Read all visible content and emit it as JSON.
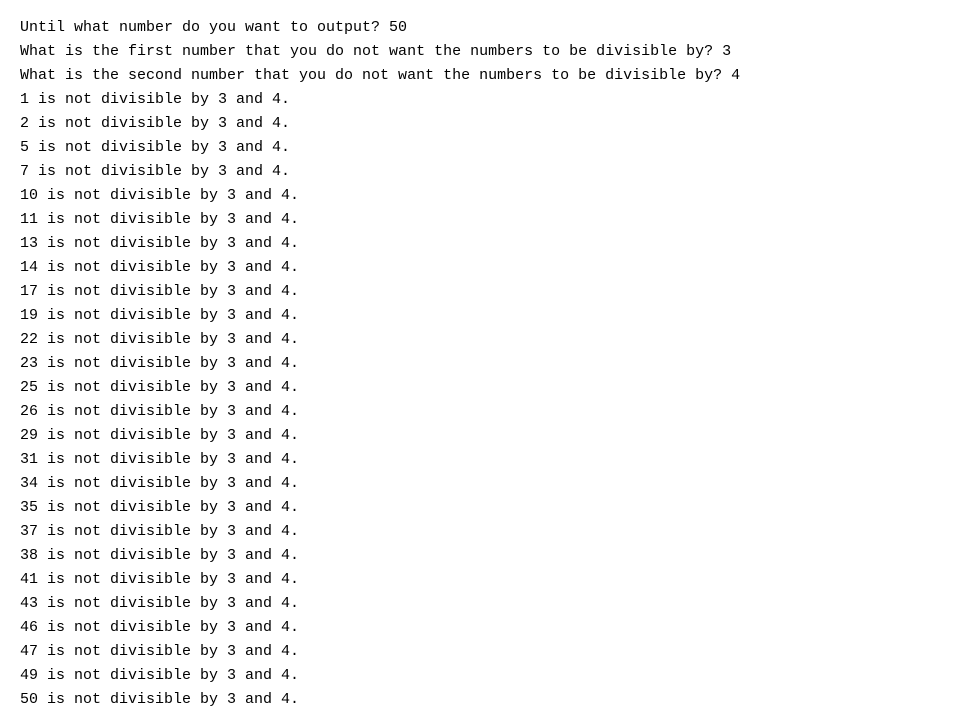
{
  "output": {
    "lines": [
      "Until what number do you want to output? 50",
      "What is the first number that you do not want the numbers to be divisible by? 3",
      "What is the second number that you do not want the numbers to be divisible by? 4",
      "1 is not divisible by 3 and 4.",
      "2 is not divisible by 3 and 4.",
      "5 is not divisible by 3 and 4.",
      "7 is not divisible by 3 and 4.",
      "10 is not divisible by 3 and 4.",
      "11 is not divisible by 3 and 4.",
      "13 is not divisible by 3 and 4.",
      "14 is not divisible by 3 and 4.",
      "17 is not divisible by 3 and 4.",
      "19 is not divisible by 3 and 4.",
      "22 is not divisible by 3 and 4.",
      "23 is not divisible by 3 and 4.",
      "25 is not divisible by 3 and 4.",
      "26 is not divisible by 3 and 4.",
      "29 is not divisible by 3 and 4.",
      "31 is not divisible by 3 and 4.",
      "34 is not divisible by 3 and 4.",
      "35 is not divisible by 3 and 4.",
      "37 is not divisible by 3 and 4.",
      "38 is not divisible by 3 and 4.",
      "41 is not divisible by 3 and 4.",
      "43 is not divisible by 3 and 4.",
      "46 is not divisible by 3 and 4.",
      "47 is not divisible by 3 and 4.",
      "49 is not divisible by 3 and 4.",
      "50 is not divisible by 3 and 4."
    ]
  }
}
